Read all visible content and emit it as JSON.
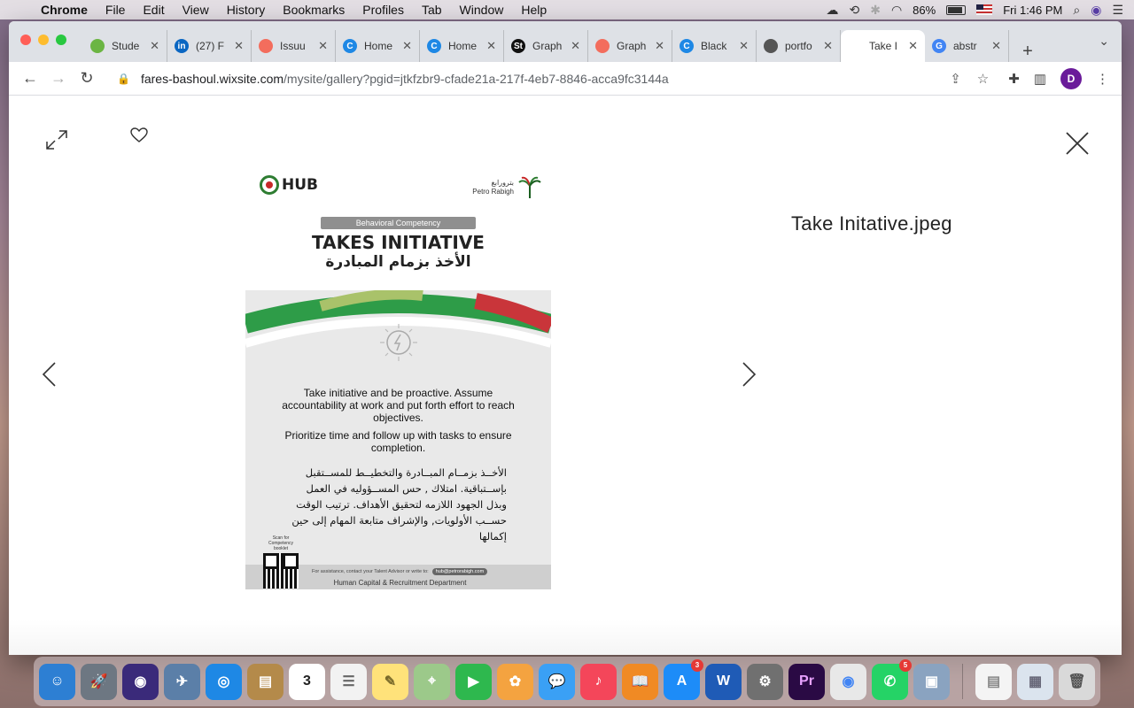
{
  "menubar": {
    "app": "Chrome",
    "items": [
      "File",
      "Edit",
      "View",
      "History",
      "Bookmarks",
      "Profiles",
      "Tab",
      "Window",
      "Help"
    ],
    "battery": "86%",
    "clock": "Fri 1:46 PM"
  },
  "tabs": [
    {
      "label": "Stude",
      "fav_color": "#6bb543",
      "fav_text": ""
    },
    {
      "label": "(27) F",
      "fav_color": "#0a66c2",
      "fav_text": "in"
    },
    {
      "label": "Issuu",
      "fav_color": "#f36d5d",
      "fav_text": ""
    },
    {
      "label": "Home",
      "fav_color": "#1e88e5",
      "fav_text": "C"
    },
    {
      "label": "Home",
      "fav_color": "#1e88e5",
      "fav_text": "C"
    },
    {
      "label": "Graph",
      "fav_color": "#111111",
      "fav_text": "St"
    },
    {
      "label": "Graph",
      "fav_color": "#f36d5d",
      "fav_text": ""
    },
    {
      "label": "Black",
      "fav_color": "#1e88e5",
      "fav_text": "C"
    },
    {
      "label": "portfo",
      "fav_color": "#555555",
      "fav_text": ""
    },
    {
      "label": "Take I",
      "fav_color": "#ffffff",
      "fav_text": "",
      "active": true
    },
    {
      "label": "abstr",
      "fav_color": "#4285f4",
      "fav_text": "G"
    }
  ],
  "address": {
    "host": "fares-bashoul.wixsite.com",
    "path": "/mysite/gallery?pgid=jtkfzbr9-cfade21a-217f-4eb7-8846-acca9fc3144a"
  },
  "profile_initial": "D",
  "gallery": {
    "file_title": "Take Initative.jpeg"
  },
  "poster": {
    "hub_logo": "HUB",
    "pr_logo_ar": "بترورابغ",
    "pr_logo_en": "Petro Rabigh",
    "badge": "Behavioral Competency",
    "title_en": "TAKES INITIATIVE",
    "title_ar": "الأخذ بزمام المبادرة",
    "para1": "Take initiative and be proactive. Assume accountability at work and put forth effort to reach objectives.",
    "para2": "Prioritize time and follow up with tasks to ensure completion.",
    "para_ar": "الأخــذ بزمــام المبــادرة والتخطيــط للمســتقبل بإســتباقية. امتلاك , حس المســؤوليه في العمل وبذل الجهود اللازمه لتحقيق الأهداف. ترتيب الوقت حســب الأولويات, والإشراف متابعة المهام إلى حين إكمالها",
    "qr_label": "Scan for Competency booklet",
    "assist_text": "For assistance, contact your Talent Advisor or write to:",
    "email": "hub@petrorabigh.com",
    "department": "Human Capital & Recruitment Department"
  },
  "dock": {
    "apps": [
      {
        "name": "finder",
        "color": "#2d7fd3",
        "glyph": "☺"
      },
      {
        "name": "launchpad",
        "color": "#6d7782",
        "glyph": "🚀"
      },
      {
        "name": "siri",
        "color": "#3a2a7a",
        "glyph": "◉"
      },
      {
        "name": "preview",
        "color": "#5b7fa8",
        "glyph": "✈"
      },
      {
        "name": "safari",
        "color": "#1e88e5",
        "glyph": "◎"
      },
      {
        "name": "notebook",
        "color": "#b48a4a",
        "glyph": "▤"
      },
      {
        "name": "calendar",
        "color": "#ffffff",
        "glyph": "3",
        "text_color": "#222"
      },
      {
        "name": "reminders",
        "color": "#f2f2f2",
        "glyph": "☰",
        "text_color": "#666"
      },
      {
        "name": "notes",
        "color": "#ffe27a",
        "glyph": "✎",
        "text_color": "#7a6a2a"
      },
      {
        "name": "maps",
        "color": "#9cc98a",
        "glyph": "⌖"
      },
      {
        "name": "facetime",
        "color": "#2eb84e",
        "glyph": "▶"
      },
      {
        "name": "photos",
        "color": "#f4a340",
        "glyph": "✿"
      },
      {
        "name": "messages",
        "color": "#3aa0f5",
        "glyph": "💬"
      },
      {
        "name": "music",
        "color": "#f4465a",
        "glyph": "♪"
      },
      {
        "name": "books",
        "color": "#f08a24",
        "glyph": "📖"
      },
      {
        "name": "app-store",
        "color": "#1d8cf8",
        "glyph": "A",
        "badge": "3"
      },
      {
        "name": "word",
        "color": "#1f5bb6",
        "glyph": "W"
      },
      {
        "name": "system-preferences",
        "color": "#707070",
        "glyph": "⚙"
      },
      {
        "name": "premiere",
        "color": "#2a0a44",
        "glyph": "Pr",
        "text_color": "#e8a2ff"
      },
      {
        "name": "chrome",
        "color": "#e8e8e8",
        "glyph": "◉",
        "text_color": "#4285f4"
      },
      {
        "name": "whatsapp",
        "color": "#25d366",
        "glyph": "✆",
        "badge": "5"
      },
      {
        "name": "image-capture",
        "color": "#8aa3c0",
        "glyph": "▣"
      }
    ],
    "right_apps": [
      {
        "name": "document-stack",
        "color": "#f4f4f4",
        "glyph": "▤",
        "text_color": "#888"
      },
      {
        "name": "downloads-stack",
        "color": "#dbe4ee",
        "glyph": "▦",
        "text_color": "#667"
      },
      {
        "name": "trash",
        "color": "#d9d9d9",
        "glyph": "🗑",
        "text_color": "#555"
      }
    ]
  }
}
